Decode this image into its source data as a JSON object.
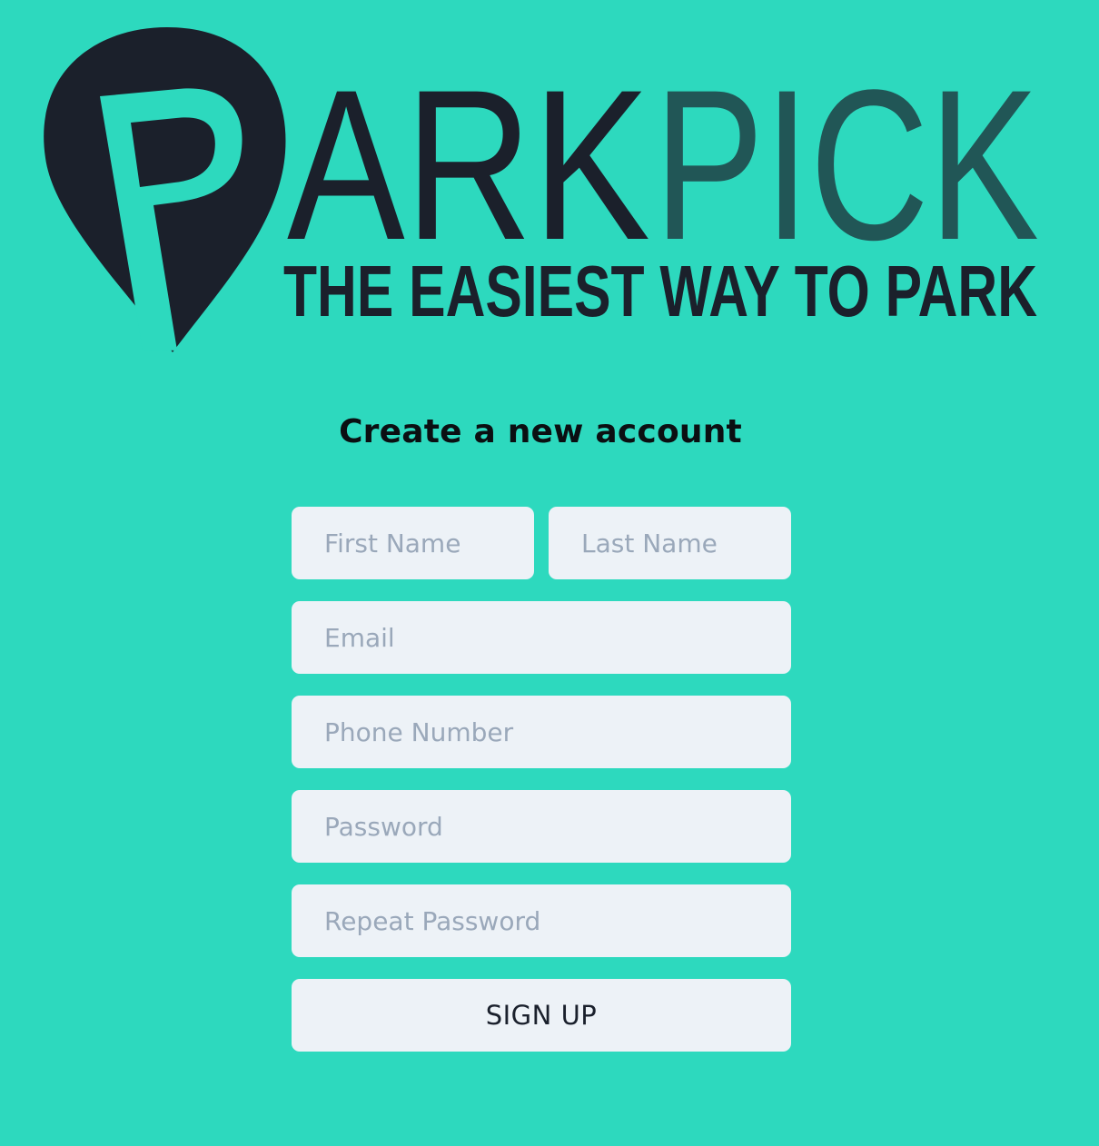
{
  "brand": {
    "word_primary": "ARK",
    "word_secondary": "PICK",
    "tagline": "THE EASIEST WAY TO PARK",
    "primary_color": "#1b202b",
    "secondary_color": "#215656"
  },
  "page": {
    "background": "#2dd9be",
    "title": "Create a new account"
  },
  "form": {
    "first_name": {
      "placeholder": "First Name",
      "value": ""
    },
    "last_name": {
      "placeholder": "Last Name",
      "value": ""
    },
    "email": {
      "placeholder": "Email",
      "value": ""
    },
    "phone": {
      "placeholder": "Phone Number",
      "value": ""
    },
    "password": {
      "placeholder": "Password",
      "value": ""
    },
    "repeat_password": {
      "placeholder": "Repeat Password",
      "value": ""
    },
    "submit_label": "SIGN UP"
  }
}
